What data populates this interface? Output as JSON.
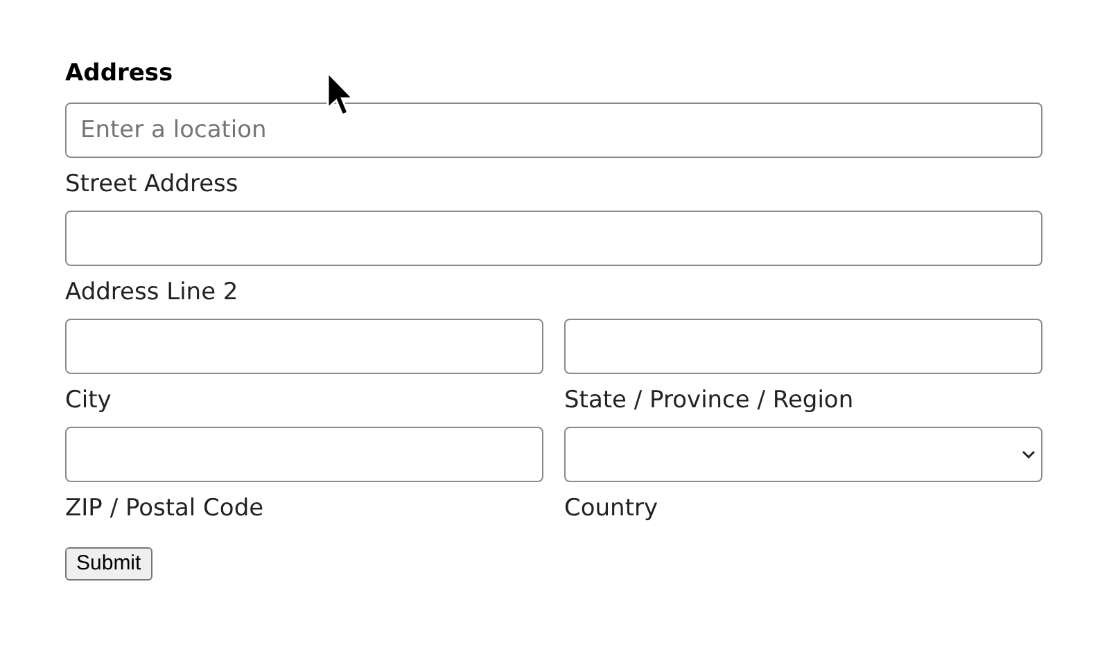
{
  "heading": "Address",
  "rows": [
    [
      {
        "kind": "text",
        "placeholder": "Enter a location",
        "label": "Street Address"
      }
    ],
    [
      {
        "kind": "text",
        "label": "Address Line 2"
      }
    ],
    [
      {
        "kind": "text",
        "label": "City"
      },
      {
        "kind": "text",
        "label": "State / Province / Region"
      }
    ],
    [
      {
        "kind": "text",
        "label": "ZIP / Postal Code"
      },
      {
        "kind": "select",
        "label": "Country"
      }
    ]
  ],
  "submit": "Submit"
}
